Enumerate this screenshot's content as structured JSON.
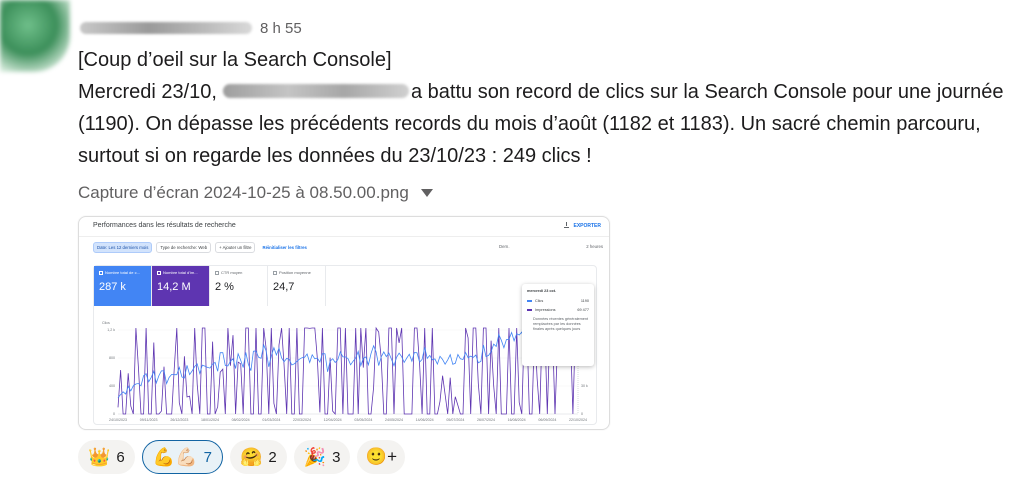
{
  "message": {
    "time": "8 h 55",
    "paragraph1": "[Coup d’oeil sur la Search Console]",
    "paragraph2_prefix": "Mercredi 23/10,",
    "paragraph2_suffix": "a battu son record de clics sur la Search Console pour une journée (1190). On dépasse les précédents records du mois d’août (1182 et 1183). Un sacré chemin parcouru, surtout si on regarde les données du 23/10/23 : 249 clics !",
    "attachment_name": "Capture d’écran 2024-10-25 à 08.50.00.png"
  },
  "screenshot": {
    "title": "Performances dans les résultats de recherche",
    "export_label": "EXPORTER",
    "filters": [
      "Date: Les 12 derniers mois",
      "Type de recherche: Web",
      "+ Ajouter un filtre"
    ],
    "reset_label": "Réinitialiser les filtres",
    "left_meta": "Dern.",
    "right_meta": "2 heures",
    "metrics": [
      {
        "label": "Nombre total de c...",
        "value": "287 k",
        "style": "blue"
      },
      {
        "label": "Nombre total d'im...",
        "value": "14,2 M",
        "style": "purple"
      },
      {
        "label": "CTR moyen",
        "value": "2 %",
        "style": "plain"
      },
      {
        "label": "Position moyenne",
        "value": "24,7",
        "style": "plain"
      }
    ],
    "tooltip": {
      "date": "mercredi 23 oct.",
      "clicks_label": "Clics",
      "clicks_value": "1190",
      "impr_label": "Impressions",
      "impr_value": "69 477",
      "note": "Données récentes généralement remplacées par les données finales après quelques jours"
    },
    "colors": {
      "clicks": "#4285f4",
      "impressions": "#5e35b1"
    },
    "axes": {
      "left_title": "Clics",
      "right_title": "Impressions",
      "left_ticks": [
        "1,2 k",
        "800",
        "400",
        "0"
      ],
      "right_ticks": [
        "90 k",
        "60 k",
        "30 k",
        "0"
      ],
      "x_ticks": [
        "24/10/2023",
        "09/11/2023",
        "26/12/2023",
        "18/01/2024",
        "08/02/2024",
        "01/03/2024",
        "22/03/2024",
        "12/04/2024",
        "03/05/2024",
        "24/05/2024",
        "14/06/2024",
        "05/07/2024",
        "26/07/2024",
        "16/08/2024",
        "06/09/2024",
        "22/10/2024"
      ]
    }
  },
  "chart_data": {
    "type": "line",
    "x": [
      "24/10/2023",
      "09/11/2023",
      "26/12/2023",
      "18/01/2024",
      "08/02/2024",
      "01/03/2024",
      "22/03/2024",
      "12/04/2024",
      "03/05/2024",
      "24/05/2024",
      "14/06/2024",
      "05/07/2024",
      "26/07/2024",
      "16/08/2024",
      "06/09/2024",
      "22/10/2024"
    ],
    "series": [
      {
        "name": "Clics",
        "values": [
          250,
          520,
          560,
          740,
          760,
          830,
          780,
          760,
          820,
          800,
          780,
          860,
          900,
          1150,
          1000,
          1190
        ]
      },
      {
        "name": "Impressions",
        "values": [
          8000,
          15000,
          18000,
          28000,
          30000,
          34000,
          33000,
          36000,
          40000,
          40000,
          42000,
          45000,
          48000,
          60000,
          58000,
          69477
        ]
      }
    ],
    "ylabel": "Clics",
    "ylim": [
      0,
      1200
    ],
    "y2label": "Impressions",
    "y2lim": [
      0,
      90000
    ]
  },
  "reactions": [
    {
      "emoji": "👑",
      "count": "6",
      "mine": false
    },
    {
      "emoji": "💪💪🏻",
      "count": "7",
      "mine": true
    },
    {
      "emoji": "🤗",
      "count": "2",
      "mine": false
    },
    {
      "emoji": "🎉",
      "count": "3",
      "mine": false
    }
  ],
  "add_reaction_icon": "🙂+"
}
